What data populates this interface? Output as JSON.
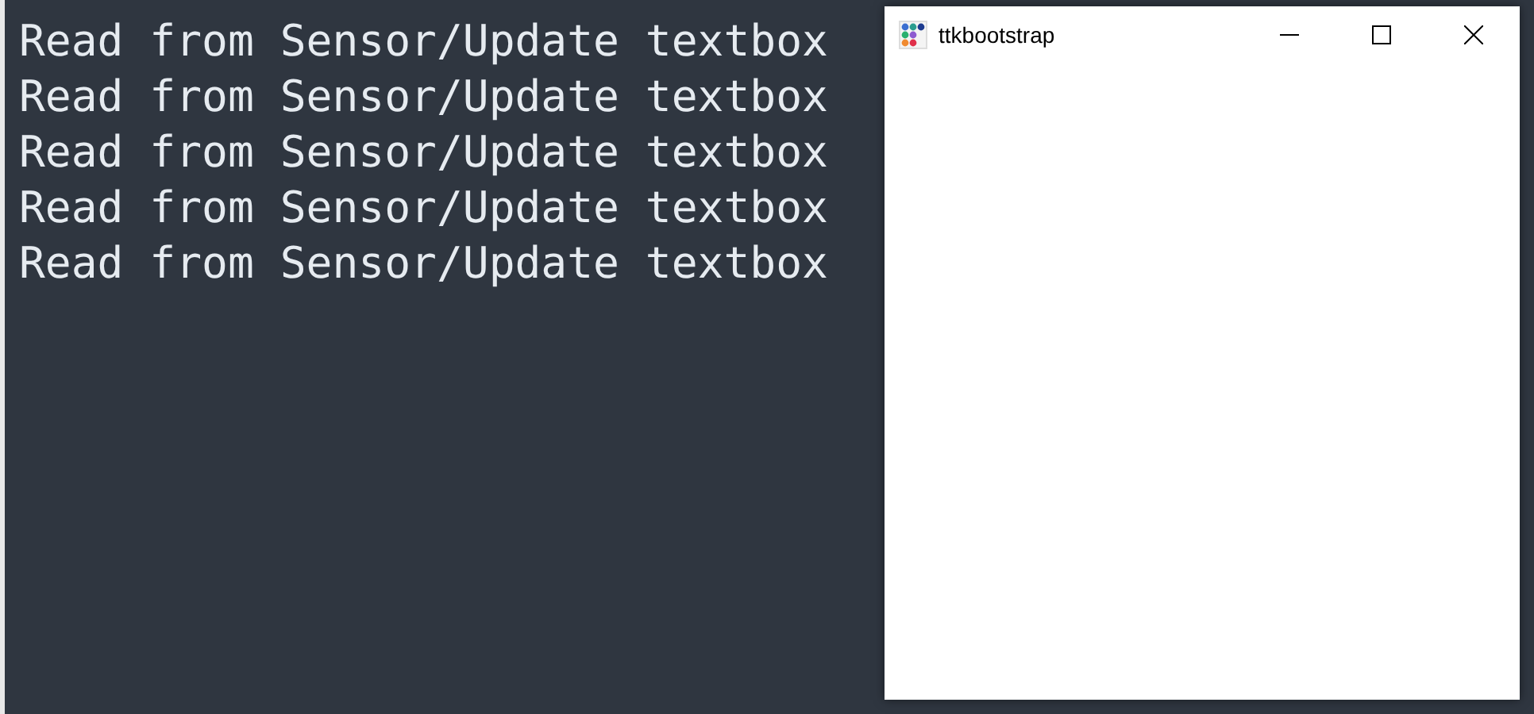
{
  "terminal": {
    "lines": [
      "Read from Sensor/Update textbox",
      "Read from Sensor/Update textbox",
      "Read from Sensor/Update textbox",
      "Read from Sensor/Update textbox",
      "Read from Sensor/Update textbox"
    ]
  },
  "window": {
    "title": "ttkbootstrap"
  }
}
